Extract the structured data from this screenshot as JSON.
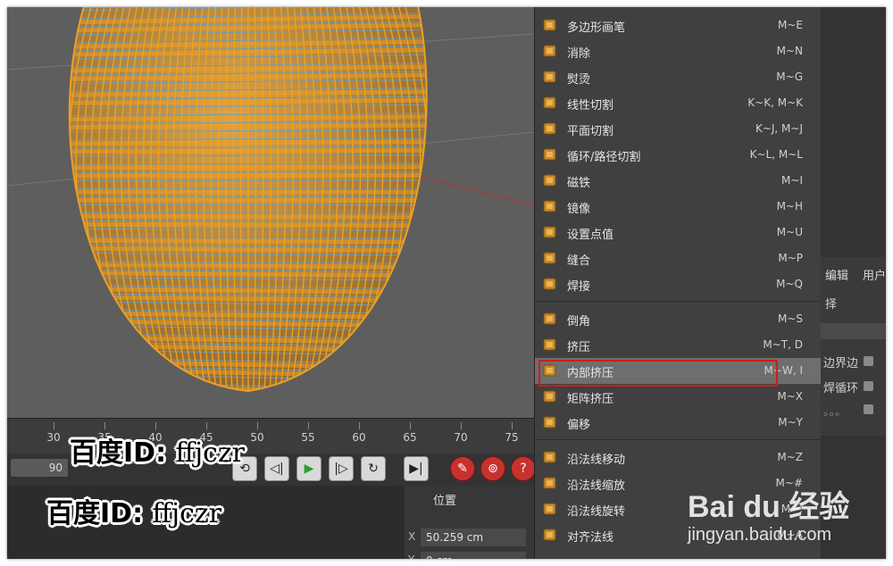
{
  "menu_items": [
    {
      "label": "多边形画笔",
      "shortcut": "M~E",
      "icon": "polygon-pen-icon"
    },
    {
      "label": "消除",
      "shortcut": "M~N",
      "icon": "dissolve-icon"
    },
    {
      "label": "熨烫",
      "shortcut": "M~G",
      "icon": "iron-icon"
    },
    {
      "label": "线性切割",
      "shortcut": "K~K, M~K",
      "icon": "knife-icon"
    },
    {
      "label": "平面切割",
      "shortcut": "K~J, M~J",
      "icon": "plane-cut-icon"
    },
    {
      "label": "循环/路径切割",
      "shortcut": "K~L, M~L",
      "icon": "loop-cut-icon"
    },
    {
      "label": "磁铁",
      "shortcut": "M~I",
      "icon": "magnet-icon"
    },
    {
      "label": "镜像",
      "shortcut": "M~H",
      "icon": "mirror-icon"
    },
    {
      "label": "设置点值",
      "shortcut": "M~U",
      "icon": "set-point-icon"
    },
    {
      "label": "缝合",
      "shortcut": "M~P",
      "icon": "stitch-icon"
    },
    {
      "label": "焊接",
      "shortcut": "M~Q",
      "icon": "weld-icon"
    },
    {
      "label": "倒角",
      "shortcut": "M~S",
      "icon": "bevel-icon"
    },
    {
      "label": "挤压",
      "shortcut": "M~T, D",
      "icon": "extrude-icon"
    },
    {
      "label": "内部挤压",
      "shortcut": "M~W, I",
      "icon": "extrude-inner-icon"
    },
    {
      "label": "矩阵挤压",
      "shortcut": "M~X",
      "icon": "matrix-extrude-icon"
    },
    {
      "label": "偏移",
      "shortcut": "M~Y",
      "icon": "offset-icon"
    },
    {
      "label": "沿法线移动",
      "shortcut": "M~Z",
      "icon": "normal-move-icon"
    },
    {
      "label": "沿法线缩放",
      "shortcut": "M~#",
      "icon": "normal-scale-icon"
    },
    {
      "label": "沿法线旋转",
      "shortcut": "M~,",
      "icon": "normal-rotate-icon"
    },
    {
      "label": "对齐法线",
      "shortcut": "M~A",
      "icon": "align-normal-icon"
    }
  ],
  "highlighted_index": 13,
  "timeline": {
    "ticks": [
      "30",
      "35",
      "40",
      "45",
      "50",
      "55",
      "60",
      "65",
      "70",
      "75"
    ],
    "frame_value": "90"
  },
  "coords": {
    "title": "位置",
    "x_label": "X",
    "x_value": "50.259 cm",
    "y_label": "Y",
    "y_value": "0 cm",
    "x2_label": "X",
    "y2_label": "Y"
  },
  "attr_panel": {
    "tab_edit": "编辑",
    "tab_user": "用户",
    "row_select": "择",
    "row_boundary": "边界边",
    "row_loop": "焊循环",
    "row_dots": "。。。"
  },
  "watermark": {
    "line1_prefix": "百度ID: ",
    "line1_suffix": "ffjczr",
    "line2_prefix": "百度ID: ",
    "line2_suffix": "ffjczr"
  },
  "baidu": {
    "logo": "Bai du 经验",
    "site": "jingyan.baidu.com"
  },
  "colors": {
    "mesh_orange": "#f0a020",
    "mesh_blue": "#5b9bd5",
    "highlight": "#6e6e6e",
    "red_box": "#d01c1c"
  }
}
